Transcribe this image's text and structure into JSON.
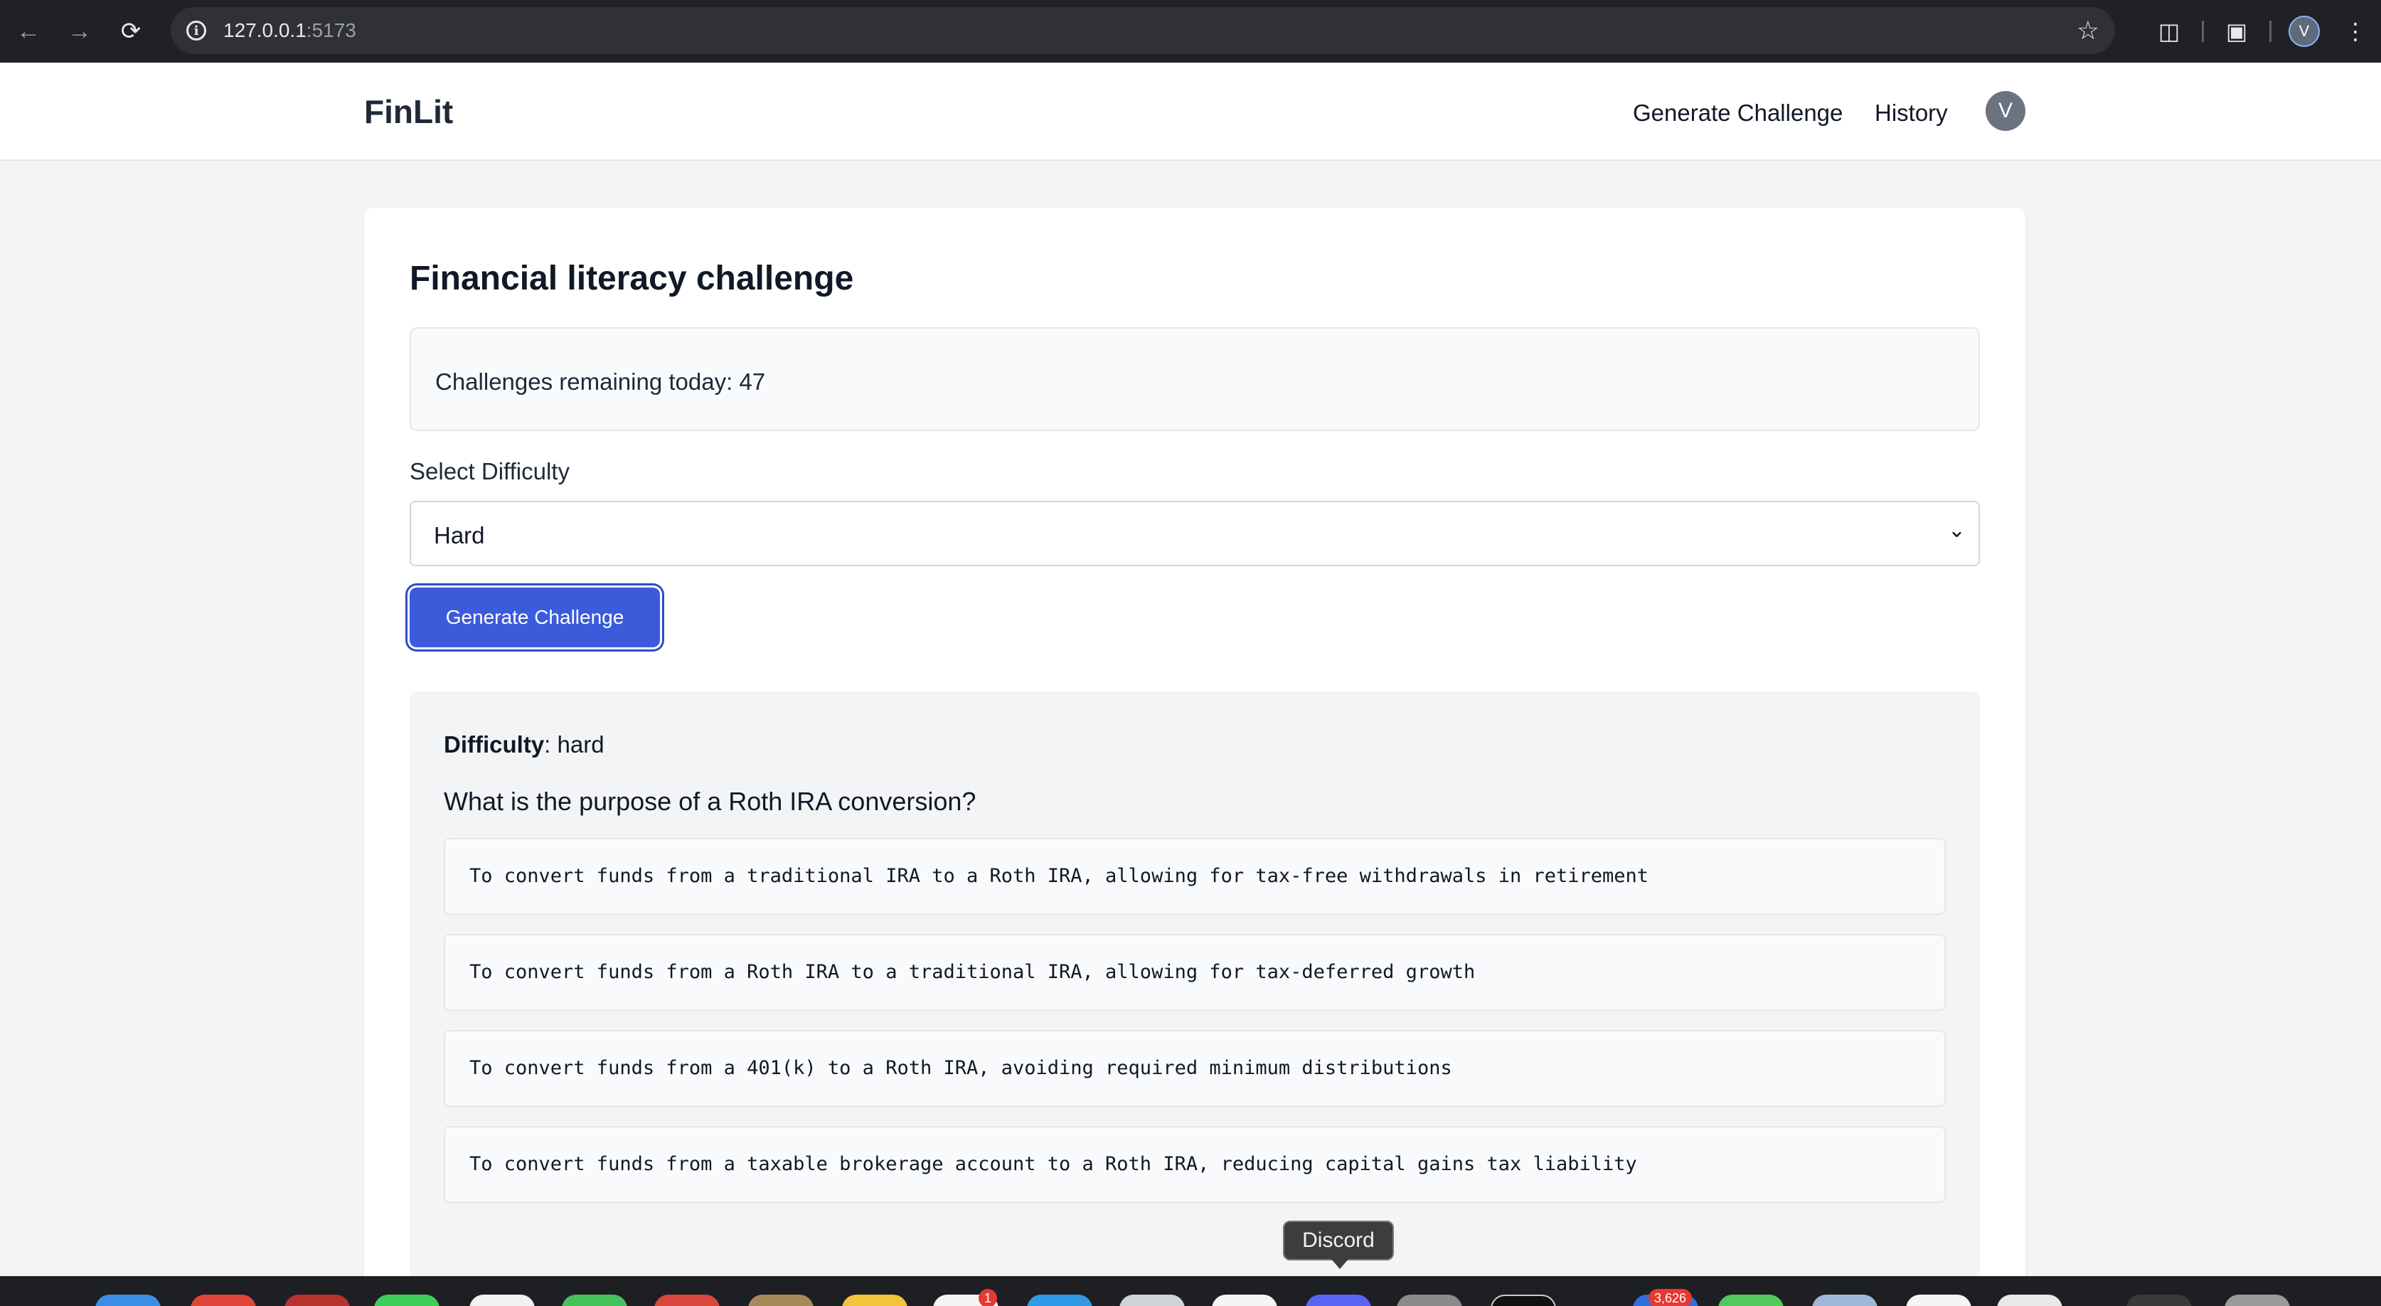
{
  "browser": {
    "url_host": "127.0.0.1",
    "url_port": ":5173",
    "profile_initial": "V"
  },
  "header": {
    "brand": "FinLit",
    "nav": [
      {
        "label": "Generate Challenge"
      },
      {
        "label": "History"
      }
    ],
    "avatar_initial": "V"
  },
  "main": {
    "title": "Financial literacy challenge",
    "quota_text": "Challenges remaining today: 47",
    "difficulty_label": "Select Difficulty",
    "difficulty_selected": "Hard",
    "generate_button": "Generate Challenge",
    "challenge": {
      "difficulty_key": "Difficulty",
      "difficulty_value": ": hard",
      "question": "What is the purpose of a Roth IRA conversion?",
      "options": [
        "To convert funds from a traditional IRA to a Roth IRA, allowing for tax-free withdrawals in retirement",
        "To convert funds from a Roth IRA to a traditional IRA, allowing for tax-deferred growth",
        "To convert funds from a 401(k) to a Roth IRA, avoiding required minimum distributions",
        "To convert funds from a taxable brokerage account to a Roth IRA, reducing capital gains tax liability"
      ]
    }
  },
  "dock": {
    "tooltip": "Discord",
    "badges": [
      "1",
      "3,626"
    ]
  },
  "colors": {
    "primary": "#3b5bdb",
    "page_bg": "#f3f4f6",
    "chrome_bg": "#202124"
  }
}
